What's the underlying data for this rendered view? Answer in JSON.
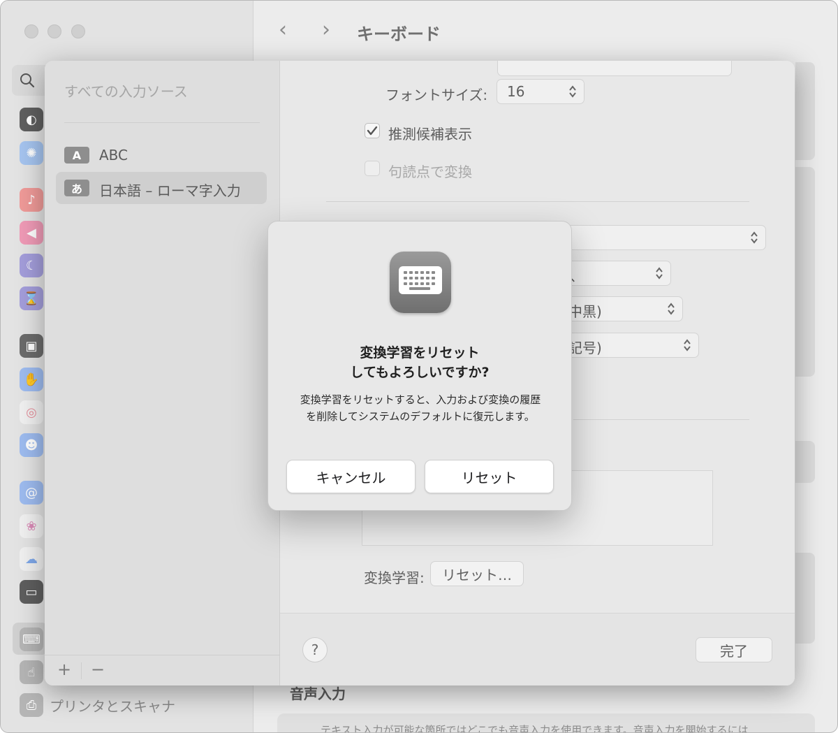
{
  "window": {
    "title": "キーボード",
    "back_icon": "‹",
    "forward_icon": "›"
  },
  "sidebar": {
    "search_icon": "search-icon",
    "bottom_item_label": "プリンタとスキャナ",
    "icons": [
      {
        "name": "appearance-icon",
        "color": "#2b2b2b"
      },
      {
        "name": "accessibility-icon",
        "color": "#3c8cf0"
      },
      {
        "name": "notifications-icon",
        "color": "#ea4b47"
      },
      {
        "name": "sound-icon",
        "color": "#e8457a"
      },
      {
        "name": "focus-icon",
        "color": "#5b4fd1"
      },
      {
        "name": "screen-time-icon",
        "color": "#5b4fd1"
      },
      {
        "name": "lock-screen-icon",
        "color": "#1e1e1e"
      },
      {
        "name": "privacy-icon",
        "color": "#3d7ce6"
      },
      {
        "name": "touch-id-icon",
        "color": "#f2f2f2"
      },
      {
        "name": "users-icon",
        "color": "#3d7ce6"
      },
      {
        "name": "internet-accounts-icon",
        "color": "#3d7ce6"
      },
      {
        "name": "game-center-icon",
        "color": "#f2f2f2"
      },
      {
        "name": "icloud-icon",
        "color": "#f2f2f2"
      },
      {
        "name": "wallet-icon",
        "color": "#1e1e1e"
      },
      {
        "name": "keyboard-icon",
        "color": "#8e8e8e"
      },
      {
        "name": "trackpad-icon",
        "color": "#8e8e8e"
      },
      {
        "name": "printers-icon",
        "color": "#8e8e8e"
      }
    ]
  },
  "sheet": {
    "sources_header": "すべての入力ソース",
    "sources": [
      {
        "badge": "A",
        "label": "ABC",
        "selected": false
      },
      {
        "badge": "あ",
        "label": "日本語 – ローマ字入力",
        "selected": true
      }
    ],
    "add_label": "+",
    "remove_label": "−",
    "font_size_label": "フォントサイズ:",
    "font_size_value": "16",
    "predictive_label": "推測候補表示",
    "predictive_checked": true,
    "punctuation_label": "句読点で変換",
    "punctuation_checked": false,
    "popup_partial_1": "、",
    "popup_partial_2": "中黒)",
    "popup_partial_3": "記号)",
    "learning_label": "変換学習:",
    "learning_reset_button": "リセット…",
    "help_label": "?",
    "done_label": "完了"
  },
  "background": {
    "voice_title": "音声入力",
    "voice_desc": "テキスト入力が可能な箇所ではどこでも音声入力を使用できます。音声入力を開始するには"
  },
  "dialog": {
    "icon": "keyboard-icon",
    "title": "変換学習をリセット\nしてもよろしいですか?",
    "message": "変換学習をリセットすると、入力および変換の履歴を削除してシステムのデフォルトに復元します。",
    "cancel_label": "キャンセル",
    "reset_label": "リセット"
  }
}
